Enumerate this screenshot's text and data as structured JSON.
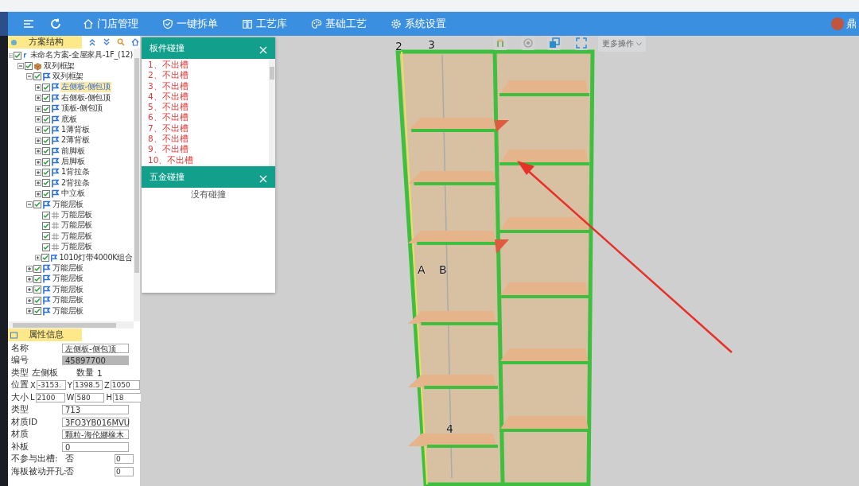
{
  "nav": {
    "items": [
      {
        "label": "门店管理"
      },
      {
        "label": "一键拆单"
      },
      {
        "label": "工艺库"
      },
      {
        "label": "基础工艺"
      },
      {
        "label": "系统设置"
      }
    ],
    "user": "鼎"
  },
  "tree_panel": {
    "title": "方案结构",
    "tree": [
      {
        "label": "未命名方案-全屋家具-1F_(12)",
        "kind": "root",
        "checked": true,
        "expanded": true,
        "selected": false,
        "children": [
          {
            "label": "双列框架",
            "kind": "group",
            "checked": true,
            "expanded": true,
            "selected": false,
            "children": [
              {
                "label": "双列框架",
                "kind": "part",
                "checked": true,
                "expanded": true,
                "selected": false,
                "children": [
                  {
                    "label": "左侧板-侧包顶",
                    "kind": "part",
                    "checked": true,
                    "expanded": false,
                    "selected": true
                  },
                  {
                    "label": "右侧板-侧包顶",
                    "kind": "part",
                    "checked": true,
                    "expanded": false,
                    "selected": false
                  },
                  {
                    "label": "顶板-侧包顶",
                    "kind": "part",
                    "checked": true,
                    "expanded": false,
                    "selected": false
                  },
                  {
                    "label": "底板",
                    "kind": "part",
                    "checked": true,
                    "expanded": false,
                    "selected": false
                  },
                  {
                    "label": "1薄背板",
                    "kind": "part",
                    "checked": true,
                    "expanded": false,
                    "selected": false
                  },
                  {
                    "label": "2薄背板",
                    "kind": "part",
                    "checked": true,
                    "expanded": false,
                    "selected": false
                  },
                  {
                    "label": "前脚板",
                    "kind": "part",
                    "checked": true,
                    "expanded": false,
                    "selected": false
                  },
                  {
                    "label": "后脚板",
                    "kind": "part",
                    "checked": true,
                    "expanded": false,
                    "selected": false
                  },
                  {
                    "label": "1背拉条",
                    "kind": "part",
                    "checked": true,
                    "expanded": false,
                    "selected": false
                  },
                  {
                    "label": "2背拉条",
                    "kind": "part",
                    "checked": true,
                    "expanded": false,
                    "selected": false
                  },
                  {
                    "label": "中立板",
                    "kind": "part",
                    "checked": true,
                    "expanded": false,
                    "selected": false
                  }
                ]
              },
              {
                "label": "万能层板",
                "kind": "part",
                "checked": true,
                "expanded": true,
                "selected": false,
                "children": [
                  {
                    "label": "万能层板",
                    "kind": "leaf",
                    "checked": true,
                    "selected": false
                  },
                  {
                    "label": "万能层板",
                    "kind": "leaf",
                    "checked": true,
                    "selected": false
                  },
                  {
                    "label": "万能层板",
                    "kind": "leaf",
                    "checked": true,
                    "selected": false
                  },
                  {
                    "label": "万能层板",
                    "kind": "leaf",
                    "checked": true,
                    "selected": false
                  },
                  {
                    "label": "1010灯带4000K组合",
                    "kind": "part",
                    "checked": true,
                    "expanded": false,
                    "selected": false
                  }
                ]
              },
              {
                "label": "万能层板",
                "kind": "part",
                "checked": true,
                "expanded": false,
                "selected": false
              },
              {
                "label": "万能层板",
                "kind": "part",
                "checked": true,
                "expanded": false,
                "selected": false
              },
              {
                "label": "万能层板",
                "kind": "part",
                "checked": true,
                "expanded": false,
                "selected": false
              },
              {
                "label": "万能层板",
                "kind": "part",
                "checked": true,
                "expanded": false,
                "selected": false
              },
              {
                "label": "万能层板",
                "kind": "part",
                "checked": true,
                "expanded": false,
                "selected": false
              }
            ]
          }
        ]
      }
    ]
  },
  "properties": {
    "title": "属性信息",
    "rows": [
      {
        "kind": "field",
        "label": "名称",
        "value": "左侧板-侧包顶"
      },
      {
        "kind": "readonly",
        "label": "编号",
        "value": "45897700"
      },
      {
        "kind": "pair",
        "label": "类型",
        "value": "左侧板",
        "label2": "数量",
        "value2": "1"
      },
      {
        "kind": "triple",
        "label": "位置",
        "fields": [
          {
            "axis": "X",
            "value": "-3153."
          },
          {
            "axis": "Y",
            "value": "1398.5"
          },
          {
            "axis": "Z",
            "value": "1050"
          }
        ]
      },
      {
        "kind": "triple",
        "label": "大小",
        "fields": [
          {
            "axis": "L",
            "value": "2100"
          },
          {
            "axis": "W",
            "value": "580"
          },
          {
            "axis": "H",
            "value": "18"
          }
        ]
      },
      {
        "kind": "field",
        "label": "类型",
        "value": "713"
      },
      {
        "kind": "field",
        "label": "材质ID",
        "value": "3FO3YB016MVU"
      },
      {
        "kind": "field",
        "label": "材质",
        "value": "颗粒-海伦娜橡木"
      },
      {
        "kind": "field",
        "label": "补板",
        "value": "0"
      },
      {
        "kind": "flag",
        "label": "不参与出槽:",
        "value": "否",
        "extra": "0"
      },
      {
        "kind": "flag",
        "label": "海板被动开孔:",
        "value": "否",
        "extra": "0"
      }
    ]
  },
  "board_collision": {
    "title": "板件碰撞",
    "items": [
      "1、不出槽",
      "2、不出槽",
      "3、不出槽",
      "4、不出槽",
      "5、不出槽",
      "6、不出槽",
      "7、不出槽",
      "8、不出槽",
      "9、不出槽",
      "10、不出槽"
    ]
  },
  "hardware_collision": {
    "title": "五金碰撞",
    "message": "没有碰撞"
  },
  "viewport": {
    "more_actions": "更多操作",
    "markers": [
      "2",
      "3",
      "A",
      "B",
      "4"
    ]
  }
}
